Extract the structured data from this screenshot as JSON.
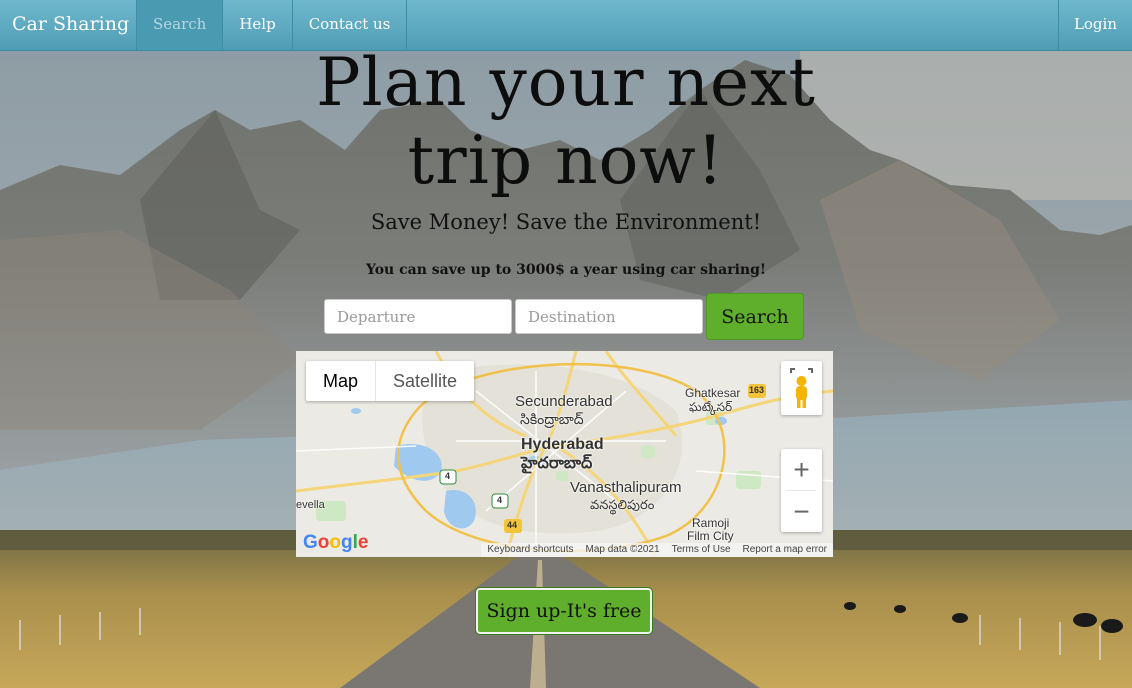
{
  "nav": {
    "brand": "Car Sharing",
    "items": [
      {
        "label": "Search",
        "active": true
      },
      {
        "label": "Help",
        "active": false
      },
      {
        "label": "Contact us",
        "active": false
      }
    ],
    "login": "Login"
  },
  "hero": {
    "headline_line1": "Plan your next",
    "headline_line2": "trip now!",
    "subhead": "Save Money! Save the Environment!",
    "tagline": "You can save up to 3000$ a year using car sharing!"
  },
  "search": {
    "departure_placeholder": "Departure",
    "destination_placeholder": "Destination",
    "button_label": "Search"
  },
  "map": {
    "type_map": "Map",
    "type_satellite": "Satellite",
    "zoom_in": "+",
    "zoom_out": "−",
    "labels": {
      "secunderabad": "Secunderabad",
      "secunderabad_te": "సికింద్రాబాద్",
      "hyderabad": "Hyderabad",
      "hyderabad_te": "హైదరాబాద్",
      "vanasthalipuram": "Vanasthalipuram",
      "vanasthalipuram_te": "వనస్థలిపురం",
      "ghatkesar": "Ghatkesar",
      "ghatkesar_te": "ఘట్కేసర్",
      "ramoji": "Ramoji",
      "film_city": "Film City",
      "evella": "evella",
      "road_163": "163",
      "road_4a": "4",
      "road_4b": "4",
      "road_44": "44"
    },
    "google": [
      "G",
      "o",
      "o",
      "g",
      "l",
      "e"
    ],
    "attribution": {
      "keyboard": "Keyboard shortcuts",
      "mapdata": "Map data ©2021",
      "terms": "Terms of Use",
      "report": "Report a map error"
    }
  },
  "signup": {
    "button_label": "Sign up-It's free"
  },
  "colors": {
    "navbar": "#5aa9c0",
    "accent_green": "#5fae2c"
  }
}
